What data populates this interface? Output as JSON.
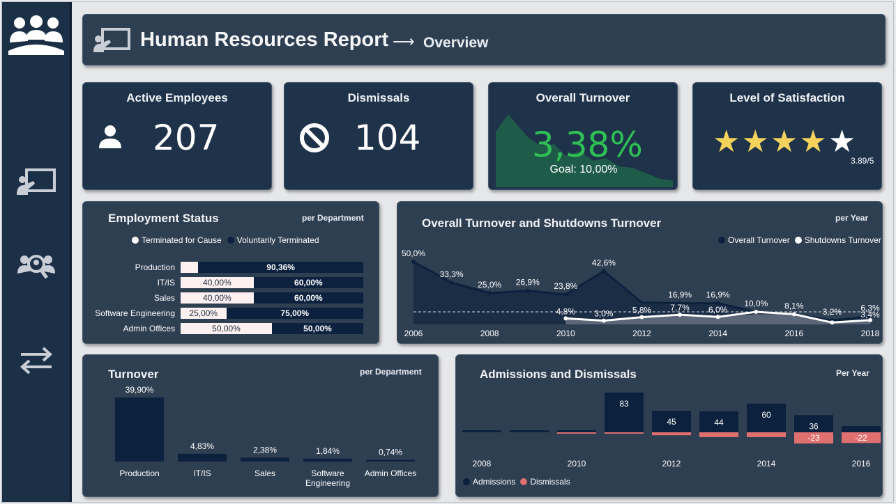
{
  "header": {
    "title": "Human Resources Report",
    "arrow": "⟶",
    "subtitle": "Overview"
  },
  "kpis": {
    "active": {
      "title": "Active Employees",
      "value": "207"
    },
    "dismissals": {
      "title": "Dismissals",
      "value": "104"
    },
    "turnover": {
      "title": "Overall Turnover",
      "value": "3,38%",
      "goal": "Goal: 10,00%",
      "check": "✓"
    },
    "satisfaction": {
      "title": "Level of Satisfaction",
      "score": "3.89/5",
      "rating": 3.89,
      "stars": [
        "★",
        "★",
        "★",
        "★",
        "★"
      ]
    }
  },
  "employment_status": {
    "title": "Employment Status",
    "per": "per Department",
    "legend": [
      "Terminated for Cause",
      "Voluntarily Terminated"
    ],
    "rows": [
      {
        "label": "Production",
        "cause": "",
        "voluntary": "90,36%",
        "cause_pct": 9.64
      },
      {
        "label": "IT/IS",
        "cause": "40,00%",
        "voluntary": "60,00%",
        "cause_pct": 40
      },
      {
        "label": "Sales",
        "cause": "40,00%",
        "voluntary": "60,00%",
        "cause_pct": 40
      },
      {
        "label": "Software Engineering",
        "cause": "25,00%",
        "voluntary": "75,00%",
        "cause_pct": 25
      },
      {
        "label": "Admin Offices",
        "cause": "50,00%",
        "voluntary": "50,00%",
        "cause_pct": 50
      }
    ]
  },
  "turnover_line": {
    "title": "Overall Turnover and Shutdowns Turnover",
    "per": "per Year",
    "legend": [
      "Overall Turnover",
      "Shutdowns Turnover"
    ],
    "x_ticks": [
      "2006",
      "2008",
      "2010",
      "2012",
      "2014",
      "2016",
      "2018"
    ]
  },
  "turnover_dept": {
    "title": "Turnover",
    "per": "per Department"
  },
  "admissions": {
    "title": "Admissions and Dismissals",
    "per": "Per Year",
    "legend": [
      "Admissions",
      "Dismissals"
    ],
    "x_ticks": [
      "2008",
      "2010",
      "2012",
      "2014",
      "2016"
    ]
  },
  "chart_data": [
    {
      "type": "line",
      "title": "Overall Turnover and Shutdowns Turnover",
      "x": [
        2006,
        2007,
        2008,
        2009,
        2010,
        2011,
        2012,
        2013,
        2014,
        2015,
        2016,
        2017,
        2018
      ],
      "series": [
        {
          "name": "Overall Turnover",
          "values": [
            50.0,
            33.3,
            25.0,
            26.9,
            23.8,
            42.6,
            null,
            16.9,
            16.9,
            10.0,
            8.1,
            3.2,
            6.3
          ],
          "labels": [
            "50,0%",
            "33,3%",
            "25,0%",
            "26,9%",
            "23,8%",
            "42,6%",
            "",
            "16,9%",
            "16,9%",
            "10,0%",
            "8,1%",
            "3,2%",
            "6,3%"
          ]
        },
        {
          "name": "Shutdowns Turnover",
          "values": [
            null,
            null,
            null,
            null,
            4.8,
            3.0,
            5.8,
            7.7,
            6.0,
            null,
            null,
            null,
            3.4
          ],
          "labels": [
            "",
            "",
            "",
            "",
            "4,8%",
            "3,0%",
            "5,8%",
            "7,7%",
            "6,0%",
            "",
            "",
            "",
            "3,4%"
          ]
        }
      ],
      "goal": 10.0
    },
    {
      "type": "bar",
      "title": "Turnover",
      "categories": [
        "Production",
        "IT/IS",
        "Sales",
        "Software Engineering",
        "Admin Offices"
      ],
      "values": [
        39.9,
        4.83,
        2.38,
        1.84,
        0.74
      ],
      "labels": [
        "39,90%",
        "4,83%",
        "2,38%",
        "1,84%",
        "0,74%"
      ]
    },
    {
      "type": "bar",
      "title": "Admissions and Dismissals",
      "categories": [
        2008,
        2009,
        2010,
        2011,
        2012,
        2013,
        2014,
        2015,
        2016
      ],
      "series": [
        {
          "name": "Admissions",
          "values": [
            1,
            2,
            3,
            83,
            45,
            44,
            60,
            36,
            13
          ],
          "labels": [
            "",
            "",
            "",
            "83",
            "45",
            "44",
            "60",
            "36",
            ""
          ]
        },
        {
          "name": "Dismissals",
          "values": [
            0,
            0,
            -1,
            -2,
            -6,
            -10,
            -10,
            -23,
            -22
          ],
          "labels": [
            "",
            "",
            "",
            "",
            "",
            "",
            "",
            "-23",
            "-22"
          ]
        }
      ]
    }
  ]
}
